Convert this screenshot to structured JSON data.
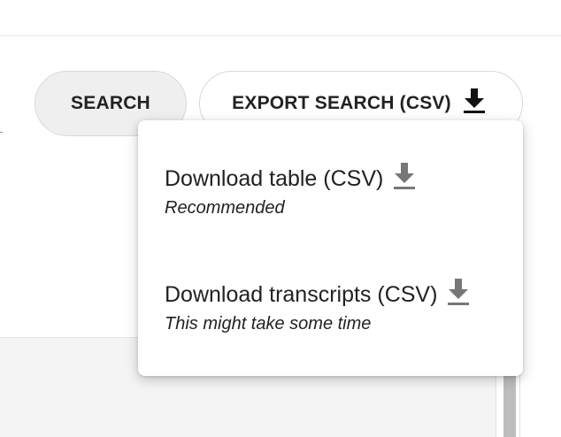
{
  "toolbar": {
    "search_label": "SEARCH",
    "export_label": "EXPORT SEARCH (CSV)",
    "export_icon": "download-icon"
  },
  "export_menu": {
    "items": [
      {
        "label": "Download table (CSV)",
        "note": "Recommended",
        "icon": "download-icon"
      },
      {
        "label": "Download transcripts (CSV)",
        "note": "This might take some time",
        "icon": "download-icon"
      }
    ]
  },
  "colors": {
    "text": "#222222",
    "search_button_bg": "#efefef",
    "menu_icon": "#777777",
    "table_bg": "#f4f4f4",
    "scroll_thumb": "#bdbdbd"
  }
}
